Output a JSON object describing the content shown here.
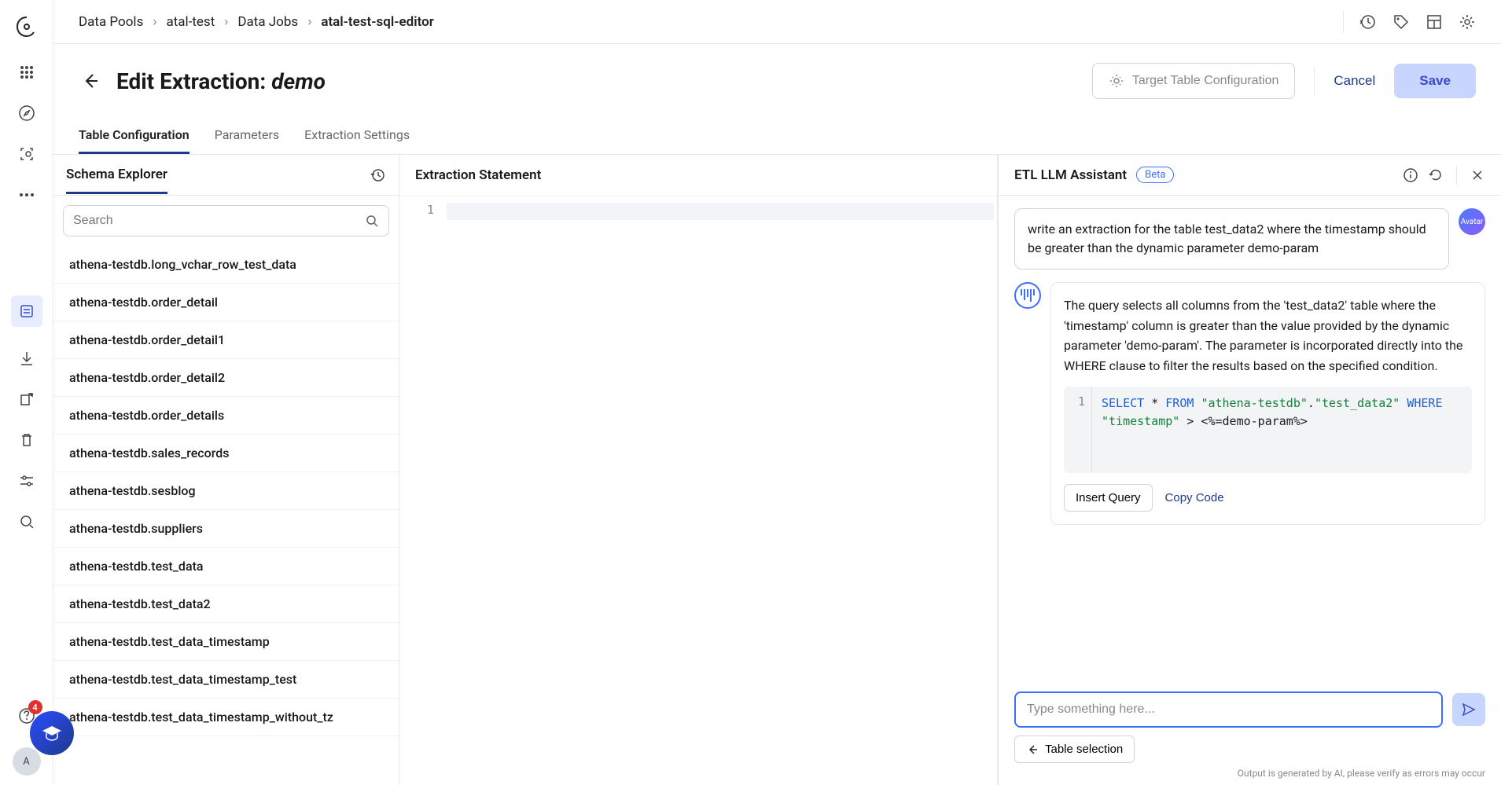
{
  "breadcrumb": [
    "Data Pools",
    "atal-test",
    "Data Jobs",
    "atal-test-sql-editor"
  ],
  "page": {
    "title_prefix": "Edit Extraction: ",
    "title_name": "demo",
    "config_btn": "Target Table Configuration",
    "cancel": "Cancel",
    "save": "Save"
  },
  "tabs": [
    "Table Configuration",
    "Parameters",
    "Extraction Settings"
  ],
  "active_tab": 0,
  "schema": {
    "title": "Schema Explorer",
    "search_placeholder": "Search",
    "items": [
      "athena-testdb.long_vchar_row_test_data",
      "athena-testdb.order_detail",
      "athena-testdb.order_detail1",
      "athena-testdb.order_detail2",
      "athena-testdb.order_details",
      "athena-testdb.sales_records",
      "athena-testdb.sesblog",
      "athena-testdb.suppliers",
      "athena-testdb.test_data",
      "athena-testdb.test_data2",
      "athena-testdb.test_data_timestamp",
      "athena-testdb.test_data_timestamp_test",
      "athena-testdb.test_data_timestamp_without_tz"
    ]
  },
  "editor": {
    "title": "Extraction Statement",
    "line_number": "1"
  },
  "assistant": {
    "title": "ETL LLM Assistant",
    "badge": "Beta",
    "user_msg": "write an extraction for the table test_data2 where the timestamp should be greater than the dynamic parameter demo-param",
    "ai_msg": "The query selects all columns from the 'test_data2' table where the 'timestamp' column is greater than the value provided by the dynamic parameter 'demo-param'. The parameter is incorporated directly into the WHERE clause to filter the results based on the specified condition.",
    "code_line": "1",
    "code": {
      "kw1": "SELECT",
      "star": " * ",
      "kw2": "FROM",
      "sp1": " ",
      "str1": "\"athena-testdb\"",
      "dot": ".",
      "str2": "\"test_data2\"",
      "sp2": " ",
      "kw3": "WHERE",
      "nl": " ",
      "str3": "\"timestamp\"",
      "rest": " > <%=demo-param%>"
    },
    "insert": "Insert Query",
    "copy": "Copy Code",
    "placeholder": "Type something here...",
    "back": "Table selection",
    "footer_note": "Output is generated by AI, please verify as errors may occur",
    "avatar_label": "Avatar"
  },
  "notification_count": "4",
  "user_initial": "A"
}
